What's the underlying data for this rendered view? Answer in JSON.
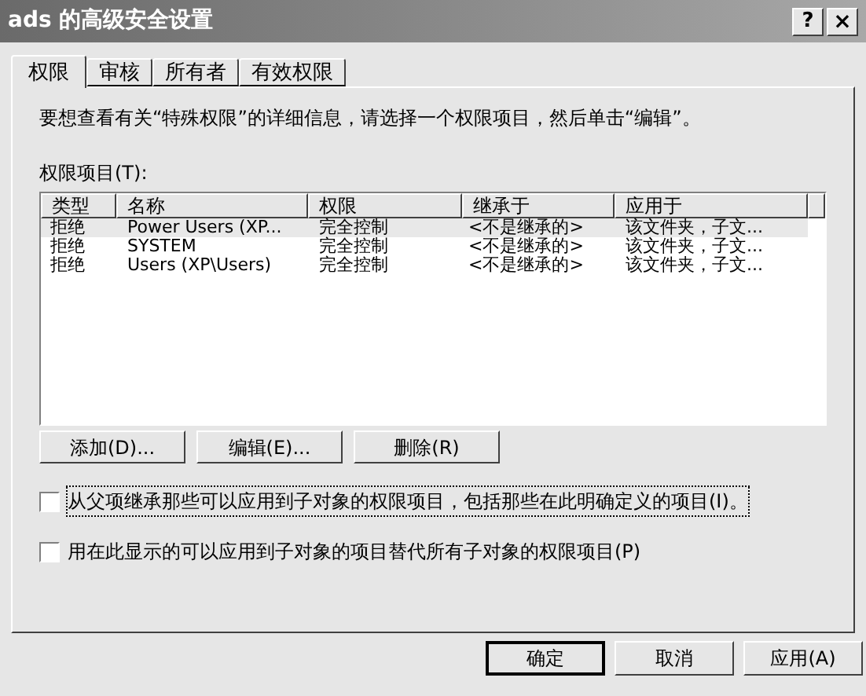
{
  "window": {
    "title": "ads 的高级安全设置",
    "help_button": "?",
    "close_button": "×"
  },
  "tabs": [
    {
      "label": "权限",
      "selected": true
    },
    {
      "label": "审核",
      "selected": false
    },
    {
      "label": "所有者",
      "selected": false
    },
    {
      "label": "有效权限",
      "selected": false
    }
  ],
  "description": "要想查看有关“特殊权限”的详细信息，请选择一个权限项目，然后单击“编辑”。",
  "list_label": "权限项目(T):",
  "table": {
    "columns": [
      "类型",
      "名称",
      "权限",
      "继承于",
      "应用于"
    ],
    "rows": [
      {
        "cells": [
          "拒绝",
          "Power Users (XP...",
          "完全控制",
          "<不是继承的>",
          "该文件夹，子文..."
        ],
        "selected": true
      },
      {
        "cells": [
          "拒绝",
          "SYSTEM",
          "完全控制",
          "<不是继承的>",
          "该文件夹，子文..."
        ],
        "selected": false
      },
      {
        "cells": [
          "拒绝",
          "Users (XP\\Users)",
          "完全控制",
          "<不是继承的>",
          "该文件夹，子文..."
        ],
        "selected": false
      }
    ]
  },
  "list_buttons": [
    "添加(D)...",
    "编辑(E)...",
    "删除(R)"
  ],
  "options": [
    {
      "label": "从父项继承那些可以应用到子对象的权限项目，包括那些在此明确定义的项目(I)。",
      "checked": false,
      "focused": true
    },
    {
      "label": "用在此显示的可以应用到子对象的项目替代所有子对象的权限项目(P)",
      "checked": false,
      "focused": false
    }
  ],
  "dialog_buttons": [
    {
      "label": "确定",
      "default": true
    },
    {
      "label": "取消",
      "default": false
    },
    {
      "label": "应用(A)",
      "default": false
    }
  ]
}
